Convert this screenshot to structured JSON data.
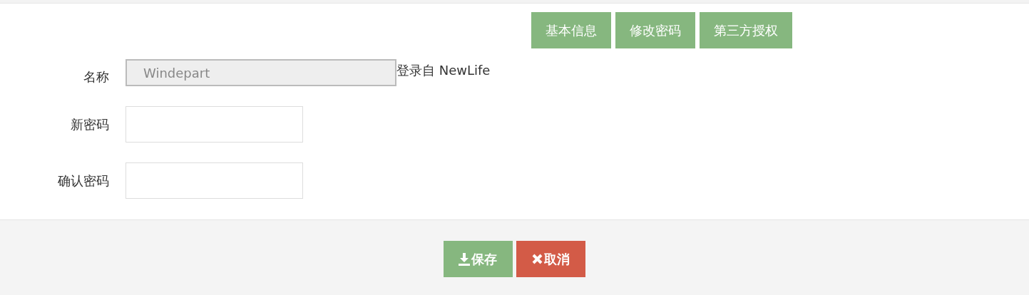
{
  "tabs": [
    {
      "label": "基本信息"
    },
    {
      "label": "修改密码"
    },
    {
      "label": "第三方授权"
    }
  ],
  "form": {
    "fields": [
      {
        "label": "名称",
        "kind": "readonly",
        "value": "Windepart",
        "note": "登录自 NewLife"
      },
      {
        "label": "新密码",
        "kind": "password"
      },
      {
        "label": "确认密码",
        "kind": "password"
      }
    ]
  },
  "buttons": [
    {
      "label": "保存",
      "kind": "save"
    },
    {
      "label": "取消",
      "kind": "cancel"
    }
  ]
}
